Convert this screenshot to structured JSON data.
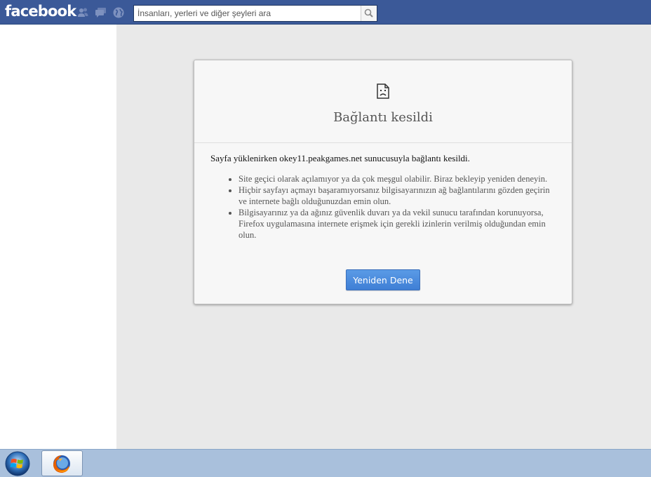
{
  "facebook_bar": {
    "logo": "facebook",
    "search_placeholder": "İnsanları, yerleri ve diğer şeyleri ara",
    "icons": [
      "friend-requests-icon",
      "messages-icon",
      "notifications-globe-icon",
      "search-icon"
    ],
    "colors": {
      "bar": "#3b5998",
      "jewel": "#7d91bf"
    }
  },
  "error_page": {
    "title": "Bağlantı kesildi",
    "lead": "Sayfa yüklenirken okey11.peakgames.net sunucusuyla bağlantı kesildi.",
    "tips": [
      "Site geçici olarak açılamıyor ya da çok meşgul olabilir. Biraz bekleyip yeniden deneyin.",
      "Hiçbir sayfayı açmayı başaramıyorsanız bilgisayarınızın ağ bağlantılarını gözden geçirin ve internete bağlı olduğunuzdan emin olun.",
      "Bilgisayarınız ya da ağınız güvenlik duvarı ya da vekil sunucu tarafından korunuyorsa, Firefox uygulamasına internete erişmek için gerekli izinlerin verilmiş olduğundan emin olun."
    ],
    "retry_label": "Yeniden Dene",
    "icon": "broken-page-icon"
  },
  "taskbar": {
    "items": [
      "windows-start-icon",
      "firefox-icon"
    ]
  }
}
